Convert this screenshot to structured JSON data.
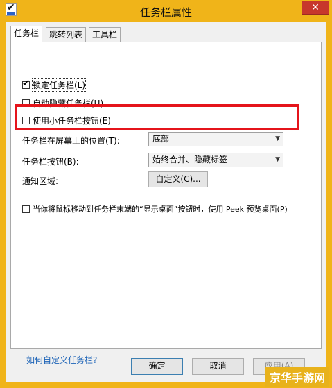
{
  "window": {
    "title": "任务栏属性",
    "close_label": "✕"
  },
  "tabs": [
    {
      "label": "任务栏",
      "active": true
    },
    {
      "label": "跳转列表",
      "active": false
    },
    {
      "label": "工具栏",
      "active": false
    }
  ],
  "checkboxes": {
    "lock": {
      "label": "锁定任务栏(L)",
      "checked": true
    },
    "autohide": {
      "label": "自动隐藏任务栏(U)",
      "checked": false
    },
    "small_buttons": {
      "label": "使用小任务栏按钮(E)",
      "checked": false
    }
  },
  "position": {
    "label": "任务栏在屏幕上的位置(T):",
    "value": "底部"
  },
  "buttons_combine": {
    "label": "任务栏按钮(B):",
    "value": "始终合并、隐藏标签"
  },
  "notification": {
    "label": "通知区域:",
    "button": "自定义(C)..."
  },
  "peek": {
    "label": "当你将鼠标移动到任务栏末端的“显示桌面”按钮时，使用 Peek 预览桌面(P)",
    "checked": false
  },
  "help_link": "如何自定义任务栏?",
  "footer": {
    "ok": "确定",
    "cancel": "取消",
    "apply": "应用(A)"
  },
  "watermark": "京华手游网",
  "colors": {
    "highlight": "#e5141b",
    "link": "#1c63b7",
    "close": "#c7372c"
  },
  "icons": {
    "app": "taskbar-properties-icon",
    "check": "checkmark-icon",
    "dropdown": "chevron-down-icon"
  }
}
